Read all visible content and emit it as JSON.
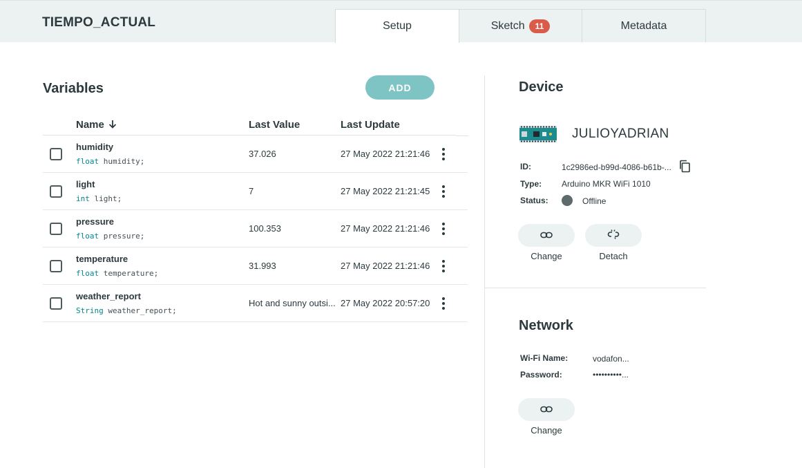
{
  "header": {
    "thing_title": "TIEMPO_ACTUAL",
    "tabs": [
      {
        "label": "Setup",
        "active": true
      },
      {
        "label": "Sketch",
        "badge": "11"
      },
      {
        "label": "Metadata"
      }
    ]
  },
  "variables": {
    "title": "Variables",
    "add_label": "ADD",
    "columns": {
      "name": "Name",
      "last_value": "Last Value",
      "last_update": "Last Update"
    },
    "sort_icon": "arrow-down-icon",
    "rows": [
      {
        "name": "humidity",
        "type": "float",
        "decl": "humidity;",
        "value": "37.026",
        "updated": "27 May 2022 21:21:46"
      },
      {
        "name": "light",
        "type": "int",
        "decl": "light;",
        "value": "7",
        "updated": "27 May 2022 21:21:45"
      },
      {
        "name": "pressure",
        "type": "float",
        "decl": "pressure;",
        "value": "100.353",
        "updated": "27 May 2022 21:21:46"
      },
      {
        "name": "temperature",
        "type": "float",
        "decl": "temperature;",
        "value": "31.993",
        "updated": "27 May 2022 21:21:46"
      },
      {
        "name": "weather_report",
        "type": "String",
        "decl": "weather_report;",
        "value": "Hot and sunny outsi...",
        "updated": "27 May 2022 20:57:20"
      }
    ]
  },
  "device": {
    "title": "Device",
    "name": "JULIOYADRIAN",
    "id_label": "ID:",
    "id_value": "1c2986ed-b99d-4086-b61b-...",
    "type_label": "Type:",
    "type_value": "Arduino MKR WiFi 1010",
    "status_label": "Status:",
    "status_value": "Offline",
    "change_label": "Change",
    "detach_label": "Detach",
    "colors": {
      "board": "#1b8c8f",
      "offline_dot": "#5f6a6d"
    }
  },
  "network": {
    "title": "Network",
    "wifi_label": "Wi-Fi Name:",
    "wifi_value": "vodafon...",
    "password_label": "Password:",
    "password_value": "••••••••••...",
    "change_label": "Change"
  },
  "colors": {
    "accent": "#7fc4c4",
    "badge": "#da5b4a",
    "header_bg": "#ecf1f1",
    "type_teal": "#00878f"
  }
}
